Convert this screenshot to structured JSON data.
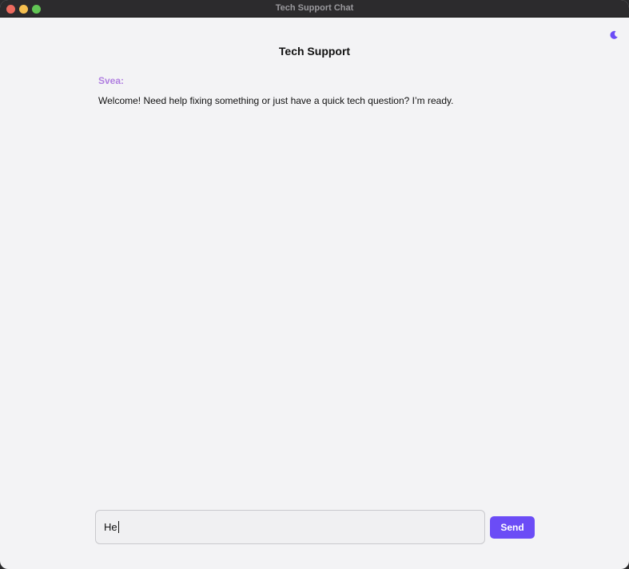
{
  "window": {
    "title": "Tech Support Chat"
  },
  "header": {
    "title": "Tech Support",
    "theme_toggle_icon": "moon-icon"
  },
  "messages": [
    {
      "sender": "Svea:",
      "text": "Welcome! Need help fixing something or just have a quick tech question? I’m ready."
    }
  ],
  "composer": {
    "input_value": "He",
    "send_label": "Send"
  },
  "colors": {
    "accent": "#6b4cf6",
    "sender_name": "#b07fe0",
    "background": "#f3f3f5",
    "titlebar": "#2c2b2d"
  }
}
